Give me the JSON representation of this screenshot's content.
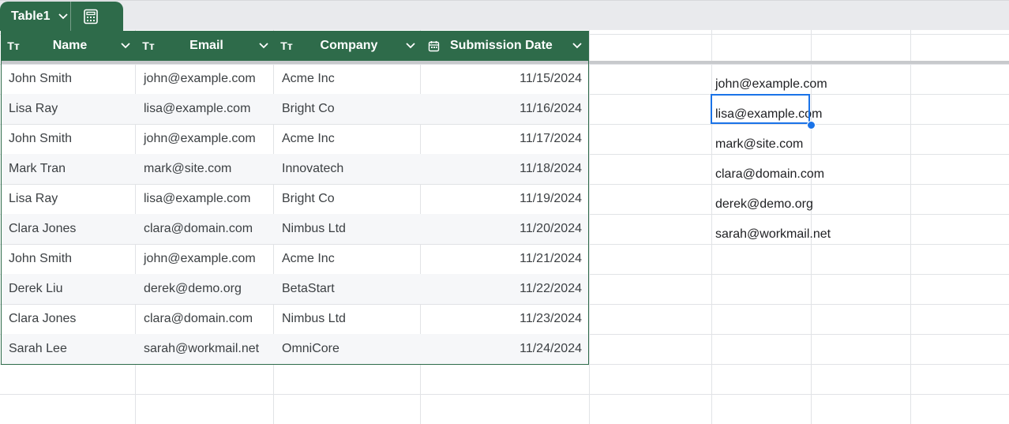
{
  "table_tab": {
    "name": "Table1",
    "calc_icon": "table-calculator-icon"
  },
  "columns": [
    {
      "label": "Name",
      "type_icon": "Tт"
    },
    {
      "label": "Email",
      "type_icon": "Tт"
    },
    {
      "label": "Company",
      "type_icon": "Tт"
    },
    {
      "label": "Submission Date",
      "type_icon": "calendar-icon"
    }
  ],
  "rows": [
    {
      "name": "John Smith",
      "email": "john@example.com",
      "company": "Acme Inc",
      "date": "11/15/2024"
    },
    {
      "name": "Lisa Ray",
      "email": "lisa@example.com",
      "company": "Bright Co",
      "date": "11/16/2024"
    },
    {
      "name": "John Smith",
      "email": "john@example.com",
      "company": "Acme Inc",
      "date": "11/17/2024"
    },
    {
      "name": "Mark Tran",
      "email": "mark@site.com",
      "company": "Innovatech",
      "date": "11/18/2024"
    },
    {
      "name": "Lisa Ray",
      "email": "lisa@example.com",
      "company": "Bright Co",
      "date": "11/19/2024"
    },
    {
      "name": "Clara Jones",
      "email": "clara@domain.com",
      "company": "Nimbus Ltd",
      "date": "11/20/2024"
    },
    {
      "name": "John Smith",
      "email": "john@example.com",
      "company": "Acme Inc",
      "date": "11/21/2024"
    },
    {
      "name": "Derek Liu",
      "email": "derek@demo.org",
      "company": "BetaStart",
      "date": "11/22/2024"
    },
    {
      "name": "Clara Jones",
      "email": "clara@domain.com",
      "company": "Nimbus Ltd",
      "date": "11/23/2024"
    },
    {
      "name": "Sarah Lee",
      "email": "sarah@workmail.net",
      "company": "OmniCore",
      "date": "11/24/2024"
    }
  ],
  "unique_emails": [
    "john@example.com",
    "lisa@example.com",
    "mark@site.com",
    "clara@domain.com",
    "derek@demo.org",
    "sarah@workmail.net"
  ],
  "colors": {
    "table_header": "#2e6b4a",
    "selection": "#1a73e8"
  }
}
